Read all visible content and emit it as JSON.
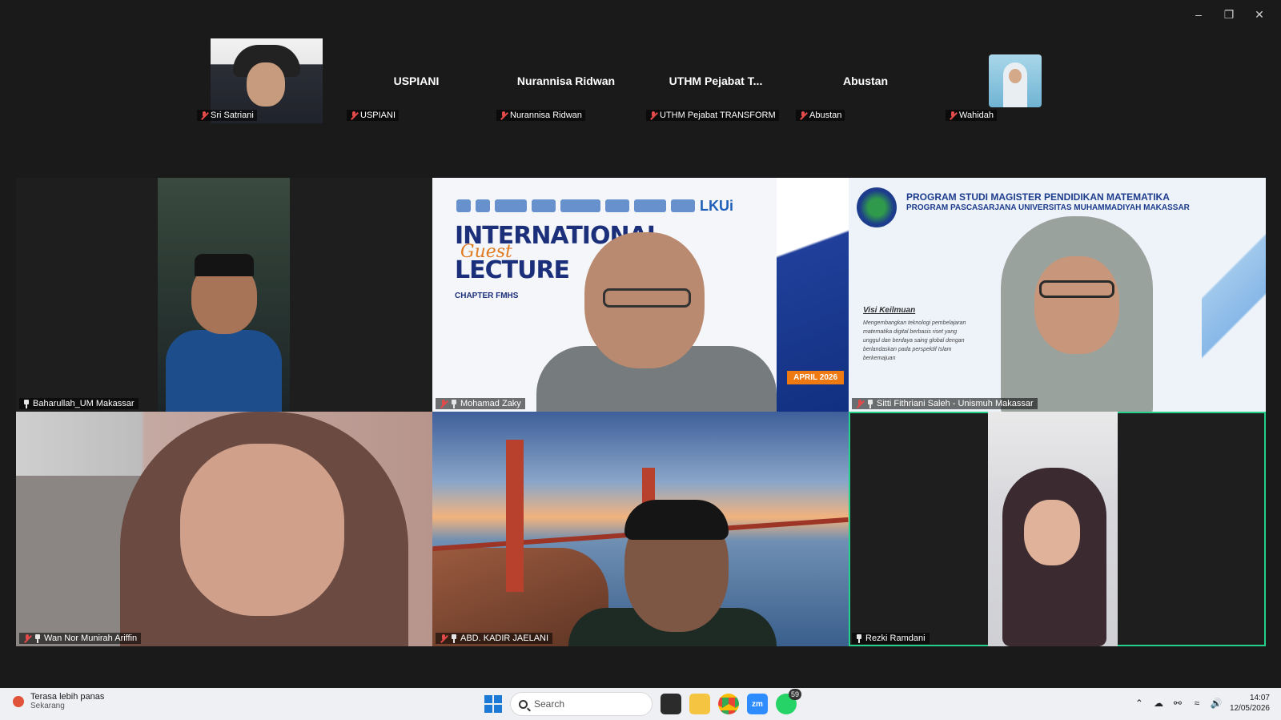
{
  "window": {
    "minimize_icon": "minimize-icon",
    "restore_icon": "restore-icon",
    "close_icon": "close-icon"
  },
  "strip": [
    {
      "tile_name": "",
      "label": "Sri Satriani",
      "has_video": true
    },
    {
      "tile_name": "USPIANI",
      "label": "USPIANI",
      "has_video": false
    },
    {
      "tile_name": "Nurannisa Ridwan",
      "label": "Nurannisa Ridwan",
      "has_video": false
    },
    {
      "tile_name": "UTHM Pejabat T...",
      "label": "UTHM Pejabat TRANSFORM",
      "has_video": false
    },
    {
      "tile_name": "Abustan",
      "label": "Abustan",
      "has_video": false
    },
    {
      "tile_name": "",
      "label": "Wahidah",
      "has_video": true
    }
  ],
  "grid": [
    {
      "label": "Baharullah_UM Makassar",
      "muted": false,
      "pinned": true
    },
    {
      "label": "Mohamad Zaky",
      "muted": true,
      "pinned": true,
      "banner": {
        "title_line1": "INTERNATIONAL",
        "title_overlay": "Guest",
        "title_line2": "LECTURE",
        "chapter": "CHAPTER FMHS",
        "date": "APRIL 2026",
        "logo_text": "LKUi"
      }
    },
    {
      "label": "Sitti Fithriani Saleh - Unismuh Makassar",
      "muted": true,
      "pinned": true,
      "program": {
        "heading1": "PROGRAM STUDI MAGISTER PENDIDIKAN MATEMATIKA",
        "heading2": "PROGRAM PASCASARJANA UNIVERSITAS MUHAMMADIYAH MAKASSAR",
        "visi_title": "Visi Keilmuan",
        "visi_text": "Mengembangkan teknologi pembelajaran matematika digital berbasis riset yang unggul dan berdaya saing global dengan berlandaskan pada perspektif Islam berkemajuan"
      }
    },
    {
      "label": "Wan Nor Munirah Ariffin",
      "muted": true,
      "pinned": true
    },
    {
      "label": "ABD. KADIR JAELANI",
      "muted": true,
      "pinned": true
    },
    {
      "label": "Rezki Ramdani",
      "muted": false,
      "pinned": true,
      "active_speaker": true
    }
  ],
  "taskbar": {
    "weather_title": "Terasa lebih panas",
    "weather_subtitle": "Sekarang",
    "search_placeholder": "Search",
    "zoom_label": "zm",
    "whatsapp_badge": "59",
    "time": "14:07",
    "date": "12/05/2026"
  },
  "colors": {
    "active_border": "#23d18b",
    "muted_icon": "#e24a4a",
    "taskbar_bg": "#eef0f3"
  }
}
